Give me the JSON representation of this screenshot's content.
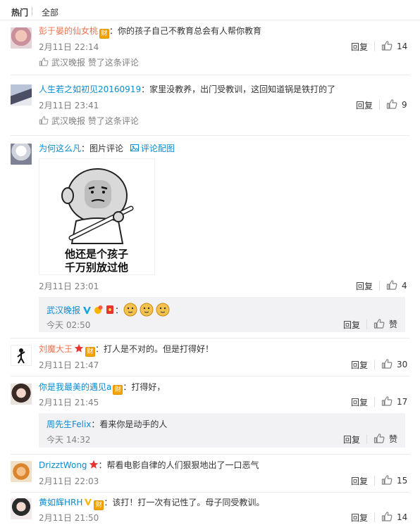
{
  "tabs": {
    "hot": "热门",
    "all": "全部"
  },
  "labels": {
    "reply": "回复",
    "like_word": "赞"
  },
  "comments": [
    {
      "user": "彭于晏的仙女桃",
      "user_color": "#eb7350",
      "badge": "财",
      "text": "：你的孩子自己不教育总会有人帮你教育",
      "time": "2月11日 22:14",
      "likes": "14",
      "liked_by": {
        "source": "武汉晚报",
        "suffix": " 赞了这条评论"
      }
    },
    {
      "user": "人生若之如初见20160919",
      "user_color": "#0a8cd2",
      "text": "：家里没教养，出门受教训，这回知道锅是铁打的了",
      "time": "2月11日 23:41",
      "likes": "9",
      "liked_by": {
        "source": "武汉晚报",
        "suffix": " 赞了这条评论"
      }
    },
    {
      "user": "为何这么凡",
      "user_color": "#0a8cd2",
      "text": "：图片评论",
      "pic_link": "评论配图",
      "meme_caption": [
        "他还是个孩子",
        "千万别放过他"
      ],
      "time": "2月11日 23:01",
      "likes": "4",
      "sub_reply": {
        "user": "武汉晚报",
        "text": "：",
        "time": "今天 02:50",
        "like": "赞"
      }
    },
    {
      "user": "刘魔大王",
      "user_color": "#eb7350",
      "badge": "财",
      "text": "：打人是不对的。但是打得好！",
      "time": "2月11日 21:47",
      "likes": "30"
    },
    {
      "user": "你是我最美的遇见a",
      "user_color": "#0a8cd2",
      "badge": "财",
      "text": "：打得好，",
      "time": "2月11日 21:45",
      "likes": "17",
      "sub_reply": {
        "user": "周先生Felix",
        "text": "：看来你是动手的人",
        "time": "今天 14:32",
        "like": "赞"
      }
    },
    {
      "user": "DrizztWong",
      "user_color": "#0a8cd2",
      "text": "：帮看电影自律的人们狠狠地出了一口恶气",
      "time": "2月11日 22:03",
      "likes": "15"
    },
    {
      "user": "黄如辉HRH",
      "user_color": "#0a8cd2",
      "badge": "财",
      "text": "：该打！打一次有记性了。母子同受教训。",
      "time": "2月11日 21:50",
      "likes": "14"
    }
  ],
  "icon_colors": {
    "orange_name": "#eb7350",
    "blue_name": "#0a8cd2",
    "gray": "#808080",
    "badge": "#f4a300"
  }
}
